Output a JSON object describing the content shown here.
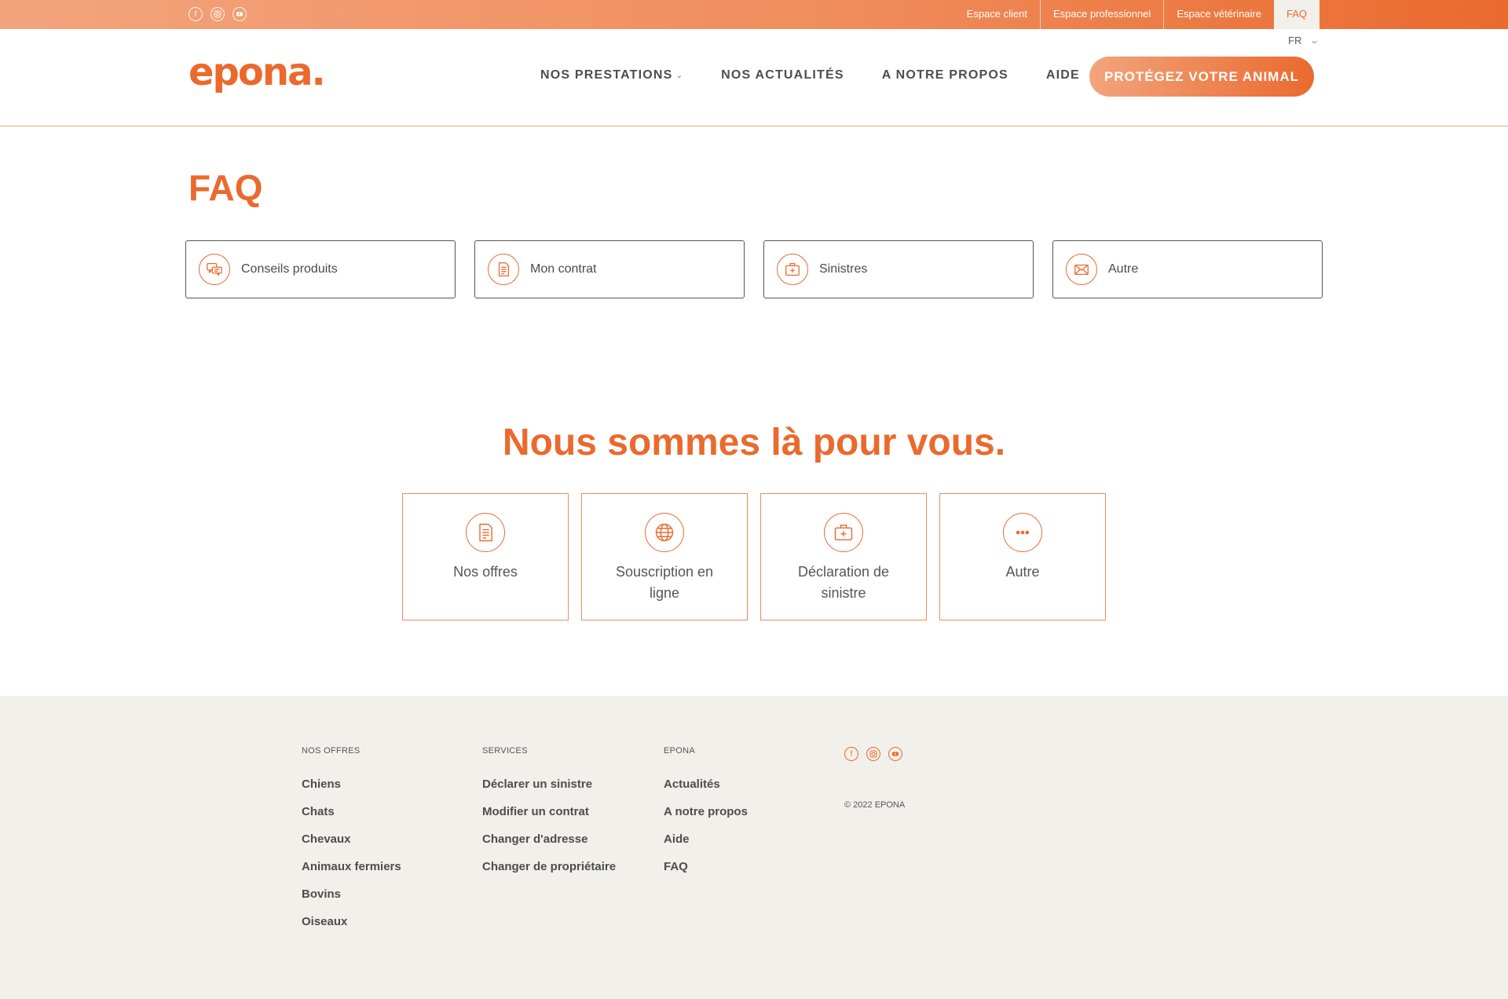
{
  "topbar": {
    "social": [
      {
        "icon": "facebook-icon",
        "glyph": "f"
      },
      {
        "icon": "instagram-icon",
        "glyph": ""
      },
      {
        "icon": "youtube-icon",
        "glyph": ""
      }
    ],
    "links": [
      "Espace client",
      "Espace professionnel",
      "Espace vétérinaire",
      "FAQ"
    ],
    "active_link": "FAQ"
  },
  "header": {
    "language": "FR",
    "logo": "epona.",
    "nav": [
      "NOS PRESTATIONS",
      "NOS ACTUALITÉS",
      "A NOTRE PROPOS",
      "AIDE"
    ],
    "cta": "PROTÉGEZ VOTRE ANIMAL"
  },
  "faq": {
    "title": "FAQ",
    "categories": [
      {
        "label": "Conseils produits",
        "icon": "chat-bubbles-icon"
      },
      {
        "label": "Mon contrat",
        "icon": "document-icon"
      },
      {
        "label": "Sinistres",
        "icon": "medical-kit-icon"
      },
      {
        "label": "Autre",
        "icon": "envelope-icon"
      }
    ]
  },
  "help": {
    "title": "Nous sommes là pour vous.",
    "cards": [
      {
        "label": "Nos offres",
        "icon": "document-icon"
      },
      {
        "label": "Souscription en ligne",
        "icon": "globe-icon"
      },
      {
        "label": "Déclaration de sinistre",
        "icon": "medical-kit-icon"
      },
      {
        "label": "Autre",
        "icon": "more-dots-icon"
      }
    ]
  },
  "footer": {
    "columns": [
      {
        "heading": "NOS OFFRES",
        "links": [
          "Chiens",
          "Chats",
          "Chevaux",
          "Animaux fermiers",
          "Bovins",
          "Oiseaux"
        ]
      },
      {
        "heading": "SERVICES",
        "links": [
          "Déclarer un sinistre",
          "Modifier un contrat",
          "Changer d'adresse",
          "Changer de propriétaire"
        ]
      },
      {
        "heading": "EPONA",
        "links": [
          "Actualités",
          "A notre propos",
          "Aide",
          "FAQ"
        ]
      }
    ],
    "copyright": "© 2022 EPONA"
  },
  "colors": {
    "accent": "#ea6a2e",
    "footer_bg": "#f1f0eb"
  }
}
